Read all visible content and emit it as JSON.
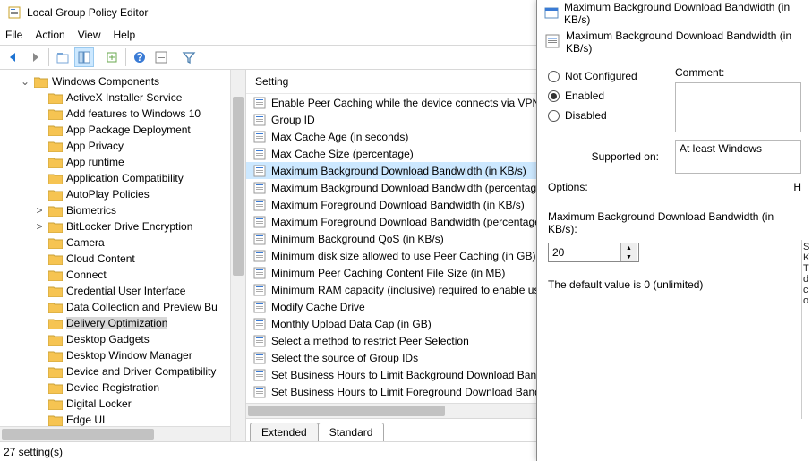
{
  "window_title": "Local Group Policy Editor",
  "menus": {
    "file": "File",
    "action": "Action",
    "view": "View",
    "help": "Help"
  },
  "tree": {
    "parent": "Windows Components",
    "items": [
      "ActiveX Installer Service",
      "Add features to Windows 10",
      "App Package Deployment",
      "App Privacy",
      "App runtime",
      "Application Compatibility",
      "AutoPlay Policies",
      "Biometrics",
      "BitLocker Drive Encryption",
      "Camera",
      "Cloud Content",
      "Connect",
      "Credential User Interface",
      "Data Collection and Preview Bu",
      "Delivery Optimization",
      "Desktop Gadgets",
      "Desktop Window Manager",
      "Device and Driver Compatibility",
      "Device Registration",
      "Digital Locker",
      "Edge UI"
    ],
    "expandable_indices": [
      7,
      8
    ],
    "selected_index": 14
  },
  "list": {
    "header": "Setting",
    "items": [
      "Enable Peer Caching while the device connects via VPN",
      "Group ID",
      "Max Cache Age (in seconds)",
      "Max Cache Size (percentage)",
      "Maximum Background Download Bandwidth (in KB/s)",
      "Maximum Background Download Bandwidth (percentage",
      "Maximum Foreground Download Bandwidth (in KB/s)",
      "Maximum Foreground Download Bandwidth (percentage",
      "Minimum Background QoS (in KB/s)",
      "Minimum disk size allowed to use Peer Caching (in GB)",
      "Minimum Peer Caching Content File Size (in MB)",
      "Minimum RAM capacity (inclusive) required to enable use",
      "Modify Cache Drive",
      "Monthly Upload Data Cap (in GB)",
      "Select a method to restrict Peer Selection",
      "Select the source of Group IDs",
      "Set Business Hours to Limit Background Download Bandw",
      "Set Business Hours to Limit Foreground Download Bandw"
    ],
    "selected_index": 4,
    "tabs": {
      "extended": "Extended",
      "standard": "Standard"
    }
  },
  "statusbar": "27 setting(s)",
  "dialog": {
    "title": "Maximum Background Download Bandwidth (in KB/s)",
    "subtitle": "Maximum Background Download Bandwidth (in KB/s)",
    "radios": {
      "not_configured": "Not Configured",
      "enabled": "Enabled",
      "disabled": "Disabled"
    },
    "selected_radio": "enabled",
    "labels": {
      "comment": "Comment:",
      "supported_on": "Supported on:",
      "supported_value": "At least Windows",
      "options": "Options:",
      "help_initial": "H",
      "field_label": "Maximum Background Download Bandwidth (in KB/s):",
      "default_note": "The default value is 0 (unlimited)"
    },
    "spinner_value": "20",
    "help_strip": "S K  T d c o"
  }
}
